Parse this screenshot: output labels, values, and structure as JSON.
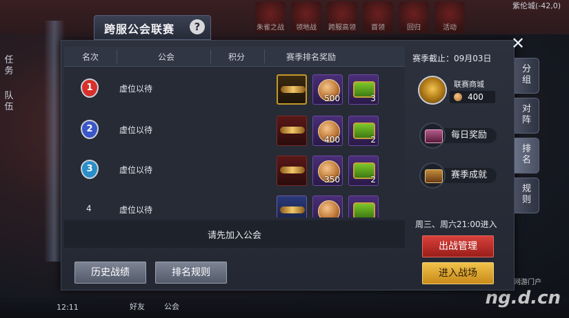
{
  "background": {
    "top_icons": [
      "朱雀之战",
      "领地战",
      "跨服高领",
      "首领",
      "回归",
      "活动"
    ],
    "coords": "紫伦城(-42,0)",
    "left_side": [
      "任务",
      "队伍"
    ],
    "clock": "12:11",
    "friends": "好友",
    "guild": "公会",
    "watermark": "ng.d.cn",
    "watermark_small": "当乐网游门户"
  },
  "panel": {
    "title": "跨服公会联赛",
    "help_icon": "?",
    "close_icon": "✕",
    "columns": [
      "名次",
      "公会",
      "积分",
      "赛季排名奖励"
    ],
    "rows": [
      {
        "rank": "1",
        "medal_color": "#d8302a",
        "guild": "虚位以待",
        "score": "",
        "rewards": [
          {
            "type": "title",
            "style": "gold",
            "count": ""
          },
          {
            "type": "coin",
            "count": "500"
          },
          {
            "type": "chest",
            "count": "3"
          }
        ]
      },
      {
        "rank": "2",
        "medal_color": "#3a56c8",
        "guild": "虚位以待",
        "score": "",
        "rewards": [
          {
            "type": "title",
            "style": "red",
            "count": ""
          },
          {
            "type": "coin",
            "count": "400"
          },
          {
            "type": "chest",
            "count": "2"
          }
        ]
      },
      {
        "rank": "3",
        "medal_color": "#2a8ec8",
        "guild": "虚位以待",
        "score": "",
        "rewards": [
          {
            "type": "title",
            "style": "red",
            "count": ""
          },
          {
            "type": "coin",
            "count": "350"
          },
          {
            "type": "chest",
            "count": "2"
          }
        ]
      },
      {
        "rank": "4",
        "medal_color": "",
        "guild": "虚位以待",
        "score": "",
        "rewards": [
          {
            "type": "title",
            "style": "blue",
            "count": ""
          },
          {
            "type": "coin",
            "count": ""
          },
          {
            "type": "chest",
            "count": ""
          }
        ]
      }
    ],
    "join_prompt": "请先加入公会",
    "history_button": "历史战绩",
    "rules_button": "排名规则"
  },
  "sidebar": {
    "season_end": "赛季截止：09月03日",
    "shop_label": "联赛商城",
    "shop_price": "400",
    "daily_reward": "每日奖励",
    "season_achievement": "赛季成就",
    "schedule": "周三、周六21:00进入",
    "battle_manage_button": "出战管理",
    "enter_battle_button": "进入战场"
  },
  "tabs": [
    "分组",
    "对阵",
    "排名",
    "规则"
  ],
  "active_tab": "排名"
}
